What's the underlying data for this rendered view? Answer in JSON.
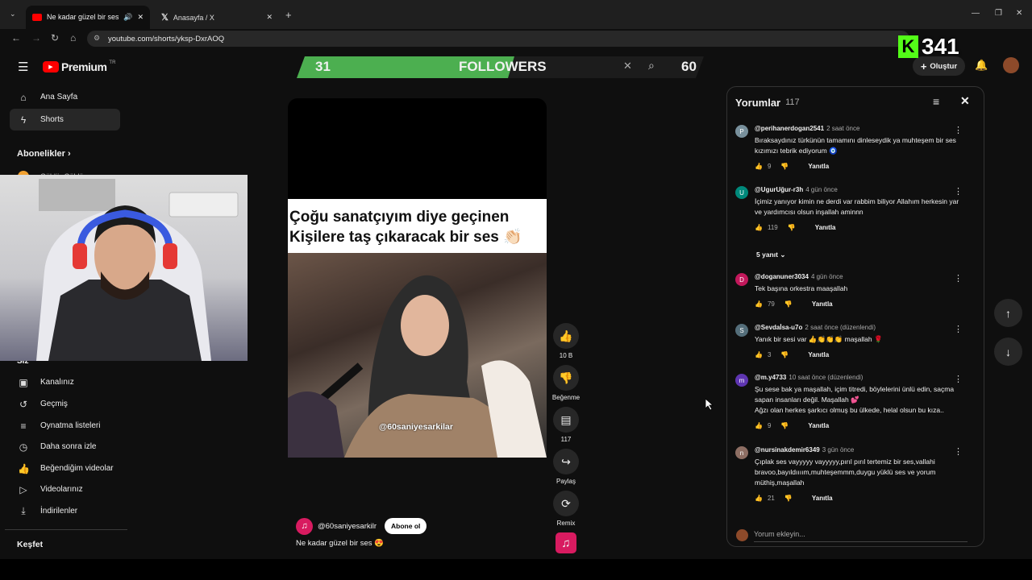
{
  "browser": {
    "tabs": [
      {
        "title": "Ne kadar güzel bir ses 😍",
        "active": true
      },
      {
        "title": "Anasayfa / X",
        "active": false
      }
    ],
    "url": "youtube.com/shorts/yksp-DxrAOQ"
  },
  "header": {
    "logo": "Premium",
    "region": "TR",
    "create_label": "Oluştur",
    "overlay_counter": "341"
  },
  "banner": {
    "left_value": "31",
    "label": "FOLLOWERS",
    "right_value": "60"
  },
  "sidebar": {
    "home": "Ana Sayfa",
    "shorts": "Shorts",
    "subscriptions": "Abonelikler",
    "partial_channel": "Güldür Güldür",
    "you": "Siz",
    "you_items": [
      "Kanalınız",
      "Geçmiş",
      "Oynatma listeleri",
      "Daha sonra izle",
      "Beğendiğim videolar",
      "Videolarınız",
      "İndirilenler"
    ],
    "explore": "Keşfet"
  },
  "video": {
    "caption_line1": "Çoğu sanatçıyım diye geçinen",
    "caption_line2": "Kişilere taş çıkaracak bir ses 👏🏻",
    "watermark": "@60saniyesarkilar",
    "channel": "@60saniyesarkilr",
    "subscribe": "Abone ol",
    "title": "Ne kadar güzel bir ses 😍"
  },
  "actions": {
    "likes": "10 B",
    "dislike": "Beğenme",
    "comments": "117",
    "share": "Paylaş",
    "remix": "Remix"
  },
  "comments": {
    "title": "Yorumlar",
    "count": "117",
    "reply_label": "Yanıtla",
    "replies_toggle": "5 yanıt",
    "add_placeholder": "Yorum ekleyin...",
    "items": [
      {
        "initial": "P",
        "color": "#78909c",
        "author": "@perihanerdogan2541",
        "time": "2 saat önce",
        "text": "Bıraksaydınız türkünün tamamını dinleseydik ya muhteşem bir ses kızımızı tebrik ediyorum 🧿",
        "likes": "9"
      },
      {
        "initial": "U",
        "color": "#00897b",
        "author": "@UgurUğur-r3h",
        "time": "4 gün önce",
        "text": "İçimiz yanıyor kimin ne derdi var rabbim biliyor Allahım herkesin yar ve yardımcısı olsun inşallah aminnn",
        "likes": "119"
      },
      {
        "initial": "D",
        "color": "#c2185b",
        "author": "@doganuner3034",
        "time": "4 gün önce",
        "text": "Tek başına orkestra maaşallah",
        "likes": "79"
      },
      {
        "initial": "S",
        "color": "#546e7a",
        "author": "@Sevdaİsa-u7o",
        "time": "2 saat önce (düzenlendi)",
        "text": "Yanık bir sesi var 👍👏👏👏 maşallah 🌹",
        "likes": "3"
      },
      {
        "initial": "m",
        "color": "#5e35b1",
        "author": "@m.y4733",
        "time": "10 saat önce (düzenlendi)",
        "text": "Şu sese bak ya maşallah, içim titredi, böylelerini ünlü edin, saçma sapan insanları değil. Maşallah 💕\nAğzı olan herkes şarkıcı olmuş bu ülkede, helal olsun bu kıza..",
        "likes": "9"
      },
      {
        "initial": "n",
        "color": "#8d6e63",
        "author": "@nursinakdemir6349",
        "time": "3 gün önce",
        "text": "Çıplak ses vayyyyy vayyyyy,pırıl pırıl tertemiz bir ses,vallahi bravoo,bayıldıııım,muhteşemmm,duygu yüklü ses ve yorum müthiş,maşallah",
        "likes": "21"
      }
    ]
  }
}
